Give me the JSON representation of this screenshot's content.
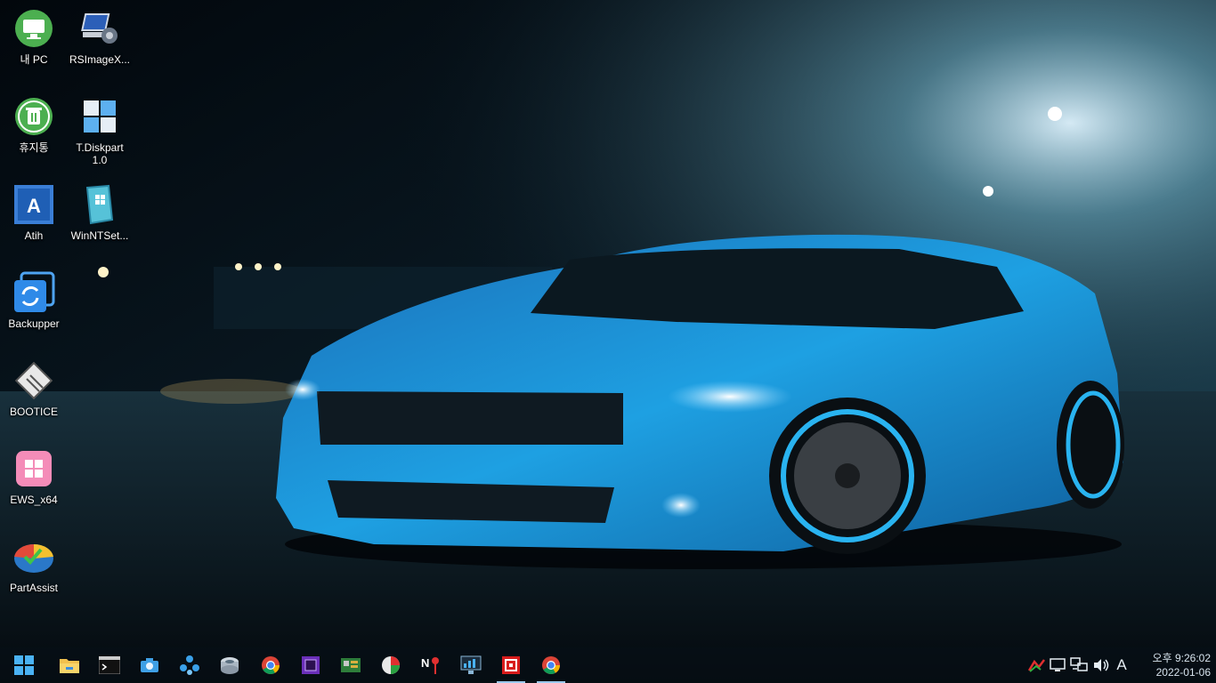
{
  "desktop": {
    "icons": [
      {
        "label": "내 PC",
        "icon": "this-pc-icon"
      },
      {
        "label": "RSImageX...",
        "icon": "rsimagex-icon"
      },
      {
        "label": "휴지통",
        "icon": "recycle-bin-icon"
      },
      {
        "label": "T.Diskpart\n1.0",
        "icon": "diskpart-icon"
      },
      {
        "label": "Atih",
        "icon": "acronis-icon"
      },
      {
        "label": "WinNTSet...",
        "icon": "winntsetup-icon"
      },
      {
        "label": "Backupper",
        "icon": "backupper-icon"
      },
      {
        "label": "BOOTICE",
        "icon": "bootice-icon"
      },
      {
        "label": "EWS_x64",
        "icon": "ews-icon"
      },
      {
        "label": "PartAssist",
        "icon": "partassist-icon"
      }
    ]
  },
  "taskbar": {
    "buttons": [
      "start-icon",
      "file-explorer-icon",
      "terminal-icon",
      "camera-icon",
      "network-tool-icon",
      "disk-tool-icon",
      "chrome-icon",
      "cpu-icon",
      "board-icon",
      "pie-chart-tool-icon",
      "nt-pass-icon",
      "monitor-tool-icon",
      "red-app-icon",
      "chrome-icon"
    ],
    "tray": {
      "ime_label": "A",
      "time": "오후 9:26:02",
      "date": "2022-01-06"
    }
  },
  "colors": {
    "taskbar_active": "#9ac8ec",
    "car_blue": "#1e8fd6"
  }
}
